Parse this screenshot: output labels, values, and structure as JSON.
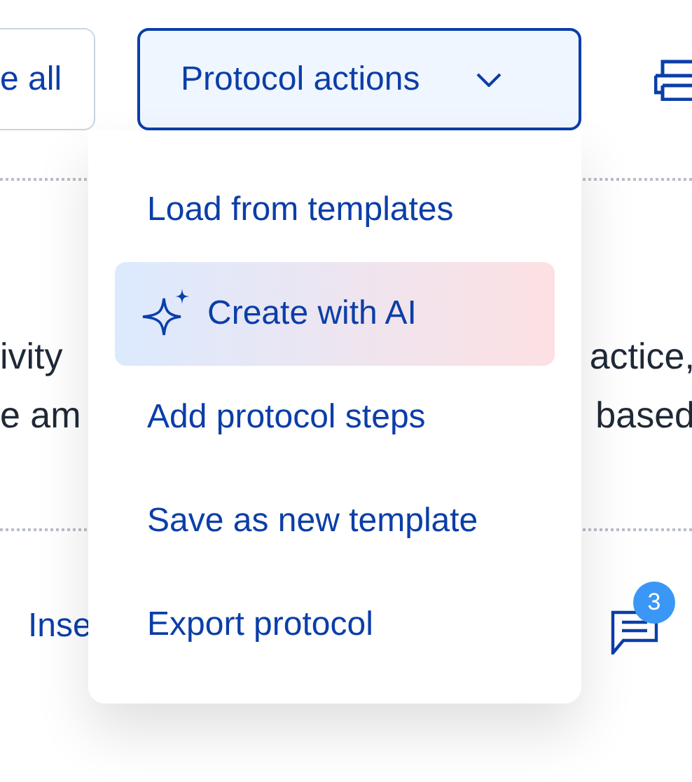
{
  "toolbar": {
    "left_button": "e all",
    "protocol_actions": {
      "label": "Protocol actions",
      "expanded": true
    }
  },
  "text_lines": [
    {
      "left": "ivity",
      "right": "actice,"
    },
    {
      "left": "e am",
      "right": "based"
    }
  ],
  "footer": {
    "link": "Inse",
    "comments_badge": "3"
  },
  "menu": [
    {
      "label": "Load from templates",
      "kind": "plain",
      "selected": false
    },
    {
      "label": "Create with AI",
      "kind": "ai",
      "selected": true
    },
    {
      "label": "Add protocol steps",
      "kind": "plain",
      "selected": false
    },
    {
      "label": "Save as new template",
      "kind": "plain",
      "selected": false
    },
    {
      "label": "Export protocol",
      "kind": "plain",
      "selected": false
    }
  ]
}
